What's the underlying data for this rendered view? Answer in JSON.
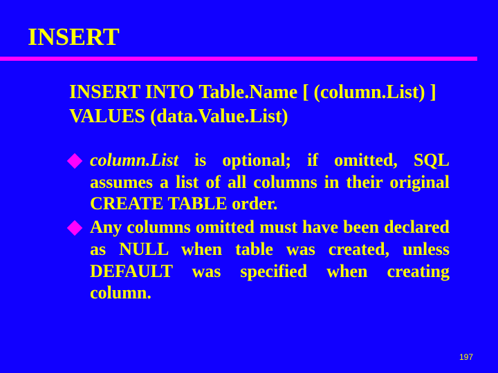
{
  "title": "INSERT",
  "syntax": {
    "line1": "INSERT INTO Table.Name [ (column.List) ]",
    "line2": "VALUES (data.Value.List)"
  },
  "bullets": [
    {
      "italic_lead": "column.List",
      "rest": " is optional; if omitted, SQL assumes a list of all columns in their original CREATE TABLE order."
    },
    {
      "italic_lead": "",
      "rest": "Any columns omitted must have been declared as NULL when table was created, unless DEFAULT was specified when creating column."
    }
  ],
  "page_number": "197"
}
